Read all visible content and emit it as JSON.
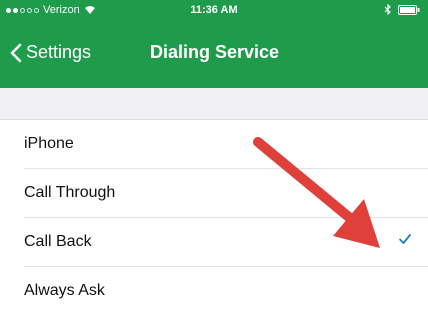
{
  "status_bar": {
    "carrier": "Verizon",
    "time": "11:36 AM",
    "wifi_icon": "wifi-icon",
    "bluetooth_icon": "bluetooth-icon",
    "battery_icon": "battery-icon"
  },
  "nav": {
    "back_label": "Settings",
    "title": "Dialing Service",
    "color": "#1e9c4c"
  },
  "options": [
    {
      "label": "iPhone",
      "selected": false
    },
    {
      "label": "Call Through",
      "selected": false
    },
    {
      "label": "Call Back",
      "selected": true
    },
    {
      "label": "Always Ask",
      "selected": false
    }
  ],
  "accent_color": "#1a7fc4",
  "annotation_arrow_color": "#e0403a"
}
